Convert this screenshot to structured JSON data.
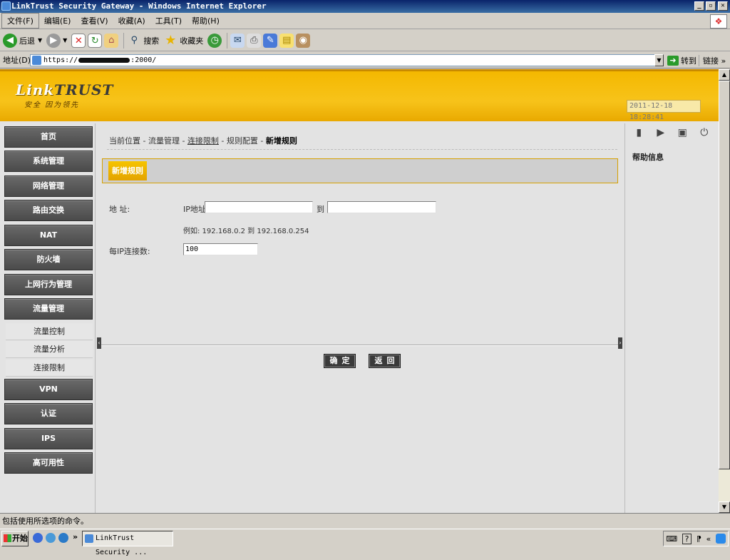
{
  "window": {
    "title": "LinkTrust Security Gateway - Windows Internet Explorer"
  },
  "menu": [
    "文件(F)",
    "编辑(E)",
    "查看(V)",
    "收藏(A)",
    "工具(T)",
    "帮助(H)"
  ],
  "toolbar": {
    "back": "后退",
    "search": "搜索",
    "favorites": "收藏夹"
  },
  "address": {
    "label": "地址(D)",
    "url_prefix": "https://",
    "url_suffix": ":2000/",
    "go": "转到",
    "links": "链接"
  },
  "header": {
    "logo_a": "Link",
    "logo_b": "TRUST",
    "slogan": "安全 因为领先",
    "datetime": "2011-12-18 18:28:41"
  },
  "nav": [
    {
      "label": "首页"
    },
    {
      "label": "系统管理"
    },
    {
      "label": "网络管理"
    },
    {
      "label": "路由交换"
    },
    {
      "label": "NAT"
    },
    {
      "label": "防火墙"
    },
    {
      "label": "上网行为管理"
    },
    {
      "label": "流量管理"
    },
    {
      "label": "VPN"
    },
    {
      "label": "认证"
    },
    {
      "label": "IPS"
    },
    {
      "label": "高可用性"
    }
  ],
  "subnav": [
    {
      "label": "流量控制"
    },
    {
      "label": "流量分析"
    },
    {
      "label": "连接限制"
    }
  ],
  "breadcrumb": {
    "current": "当前位置",
    "level1": "流量管理",
    "level2": "连接限制",
    "level3": "规则配置",
    "level4": "新增规则",
    "sep": " - "
  },
  "panel": {
    "title": "新增规则"
  },
  "form": {
    "address_label": "地 址:",
    "ip_prefix": "IP地址",
    "ip_from": "",
    "to_label": "到",
    "ip_to": "",
    "example": "例如: 192.168.0.2 到 192.168.0.254",
    "per_ip_label": "每IP连接数:",
    "per_ip_value": "100",
    "confirm": "确定",
    "back": "返回"
  },
  "right": {
    "help_title": "帮助信息"
  },
  "status": {
    "text": "包括使用所选项的命令。"
  },
  "taskbar": {
    "start": "开始",
    "task": "LinkTrust Security ..."
  }
}
